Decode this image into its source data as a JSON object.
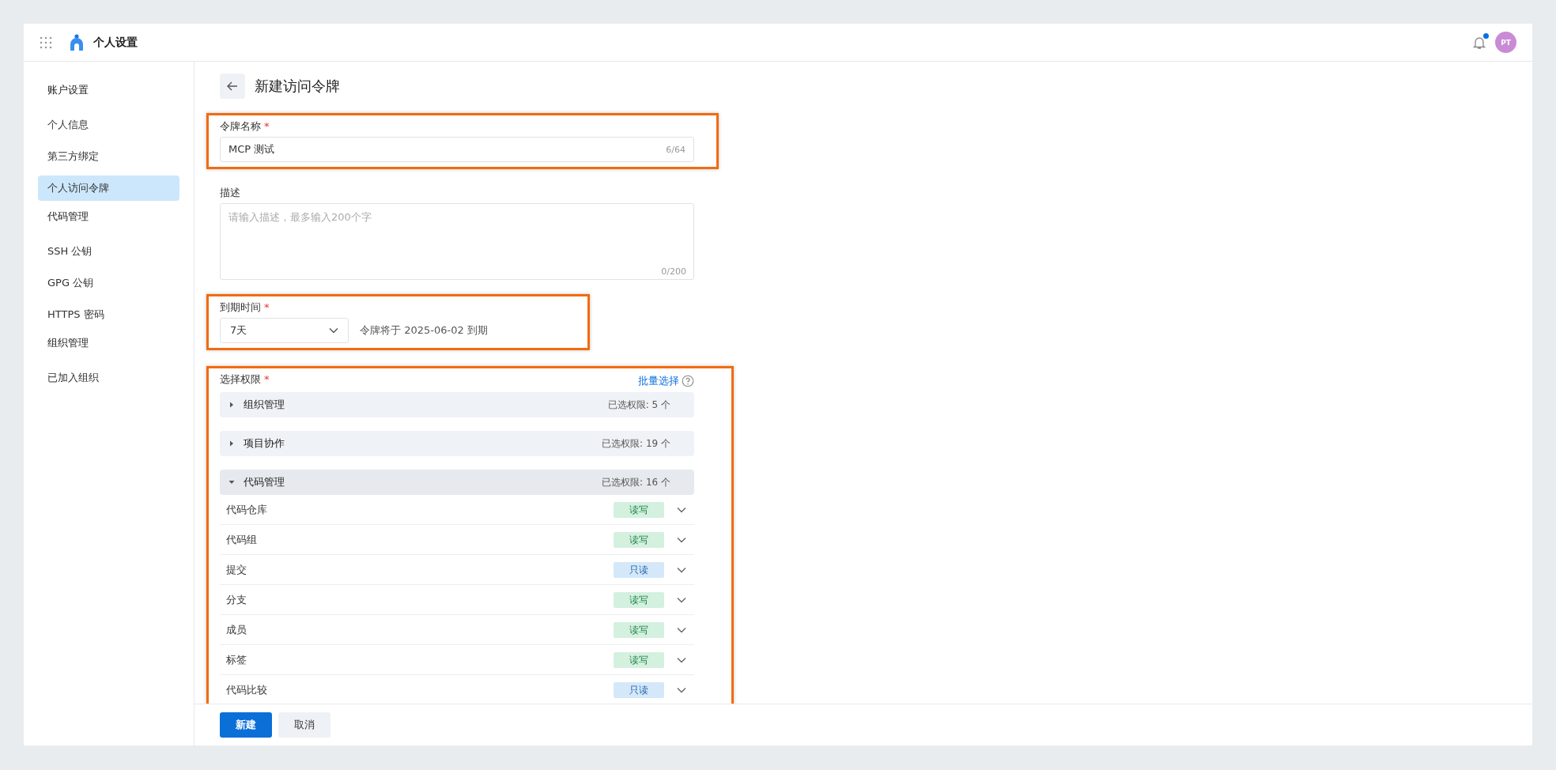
{
  "header": {
    "title": "个人设置",
    "notifications": {
      "unread": true
    },
    "avatar": "PT"
  },
  "sidebar": [
    {
      "heading": "账户设置",
      "items": [
        {
          "label": "个人信息",
          "selected": false
        },
        {
          "label": "第三方绑定",
          "selected": false
        },
        {
          "label": "个人访问令牌",
          "selected": true
        }
      ]
    },
    {
      "heading": "代码管理",
      "items": [
        {
          "label": "SSH 公钥",
          "selected": false
        },
        {
          "label": "GPG 公钥",
          "selected": false
        },
        {
          "label": "HTTPS 密码",
          "selected": false
        }
      ]
    },
    {
      "heading": "组织管理",
      "items": [
        {
          "label": "已加入组织",
          "selected": false
        }
      ]
    }
  ],
  "page_title": "新建访问令牌",
  "name_field": {
    "label": "令牌名称",
    "required_mark": "*",
    "value": "MCP 测试",
    "counter": "6/64"
  },
  "description_field": {
    "label": "描述",
    "placeholder": "请输入描述，最多输入200个字",
    "counter": "0/200"
  },
  "expiry_field": {
    "label": "到期时间",
    "required_mark": "*",
    "value": "7天",
    "hint": "令牌将于 2025-06-02 到期"
  },
  "permissions": {
    "label": "选择权限",
    "required_mark": "*",
    "batch_link": "批量选择",
    "groups": [
      {
        "name": "组织管理",
        "expanded": false,
        "count": "已选权限: 5 个"
      },
      {
        "name": "项目协作",
        "expanded": false,
        "count": "已选权限: 19 个"
      },
      {
        "name": "代码管理",
        "expanded": true,
        "count": "已选权限: 16 个",
        "items": [
          {
            "name": "代码仓库",
            "access": "读写",
            "kind": "read_write"
          },
          {
            "name": "代码组",
            "access": "读写",
            "kind": "read_write"
          },
          {
            "name": "提交",
            "access": "只读",
            "kind": "read_only"
          },
          {
            "name": "分支",
            "access": "读写",
            "kind": "read_write"
          },
          {
            "name": "成员",
            "access": "读写",
            "kind": "read_write"
          },
          {
            "name": "标签",
            "access": "读写",
            "kind": "read_write"
          },
          {
            "name": "代码比较",
            "access": "只读",
            "kind": "read_only"
          }
        ]
      }
    ]
  },
  "buttons": [
    {
      "label": "新建",
      "kind": "primary"
    },
    {
      "label": "取消",
      "kind": "secondary"
    }
  ]
}
